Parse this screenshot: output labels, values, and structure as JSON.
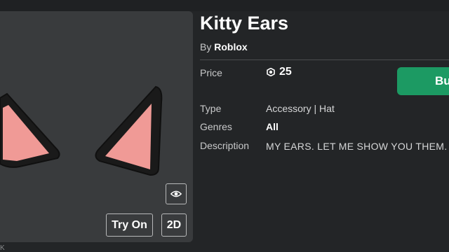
{
  "header": {
    "faded_text": ""
  },
  "item": {
    "name": "Kitty Ears",
    "by_prefix": "By",
    "creator": "Roblox"
  },
  "details": {
    "price_label": "Price",
    "price_value": "25",
    "type_label": "Type",
    "type_value": "Accessory | Hat",
    "genres_label": "Genres",
    "genres_value": "All",
    "description_label": "Description",
    "description_value": "MY EARS. LET ME SHOW YOU THEM."
  },
  "buttons": {
    "buy_label": "Bu",
    "try_on_label": "Try On",
    "two_d_label": "2D"
  },
  "icons": {
    "robux": "robux-icon",
    "eye": "eye-icon"
  },
  "colors": {
    "buy_green": "#1c9a63",
    "ear_pink": "#f09a96",
    "ear_outline": "#1a1a1a",
    "preview_bg": "#393b3d",
    "page_bg": "#232527"
  },
  "footer": {
    "fragment": "K"
  }
}
